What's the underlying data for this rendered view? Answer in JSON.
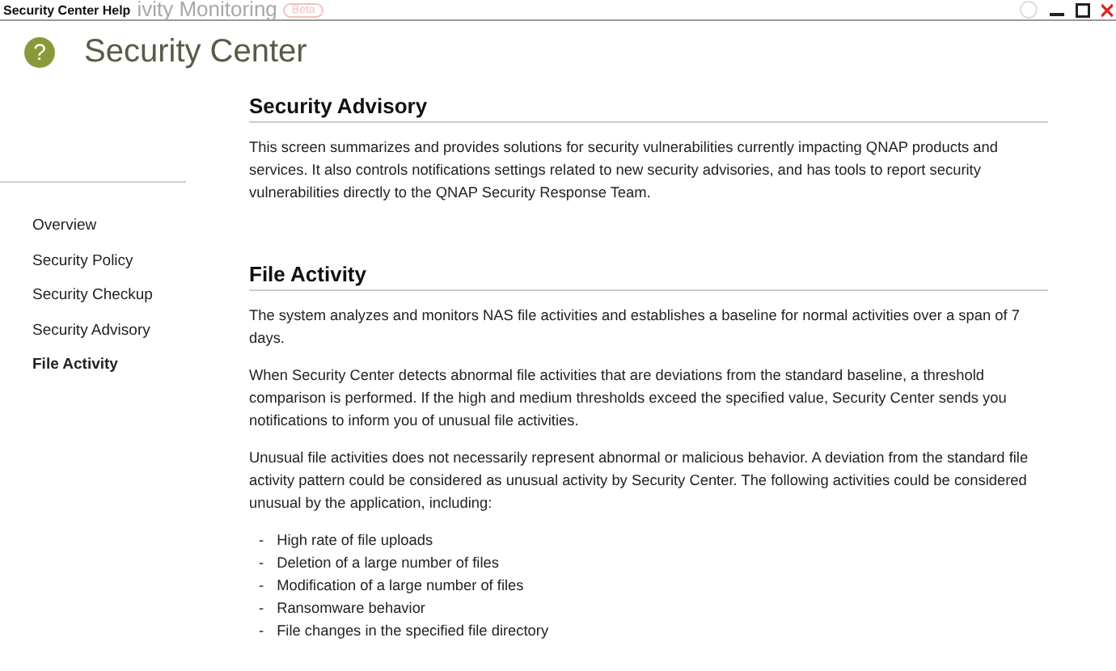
{
  "window": {
    "title": "Security Center Help",
    "background_title": "ivity Monitoring",
    "background_badge": "Beta"
  },
  "header": {
    "title": "Security Center",
    "icon_glyph": "?"
  },
  "sidebar": {
    "items": [
      {
        "label": "Overview",
        "selected": false
      },
      {
        "label": "Security Policy",
        "selected": false
      },
      {
        "label": "Security Checkup",
        "selected": false
      },
      {
        "label": "Security Advisory",
        "selected": false
      },
      {
        "label": "File Activity",
        "selected": true
      }
    ]
  },
  "sections": [
    {
      "heading": "Security Advisory",
      "blocks": [
        {
          "kind": "paragraph",
          "text": "This screen summarizes and provides solutions for security vulnerabilities currently impacting QNAP products and services. It also controls notifications settings related to new security advisories, and has tools to report security vulnerabilities directly to the QNAP Security Response Team."
        }
      ]
    },
    {
      "heading": "File Activity",
      "blocks": [
        {
          "kind": "paragraph",
          "text": "The system analyzes and monitors NAS file activities and establishes a baseline for normal activities over a span of 7 days."
        },
        {
          "kind": "paragraph",
          "text": "When Security Center detects abnormal file activities that are deviations from the standard baseline, a threshold comparison is performed. If the high and medium thresholds exceed the specified value, Security Center sends you notifications to inform you of unusual file activities."
        },
        {
          "kind": "paragraph",
          "text": "Unusual file activities does not necessarily represent abnormal or malicious behavior. A deviation from the standard file activity pattern could be considered as unusual activity by Security Center. The following activities could be considered unusual by the application, including:"
        },
        {
          "kind": "list",
          "bullet": "-",
          "items": [
            "High rate of file uploads",
            "Deletion of a large number of files",
            "Modification of a large number of files",
            "Ransomware behavior",
            "File changes in the specified file directory"
          ]
        }
      ]
    }
  ]
}
